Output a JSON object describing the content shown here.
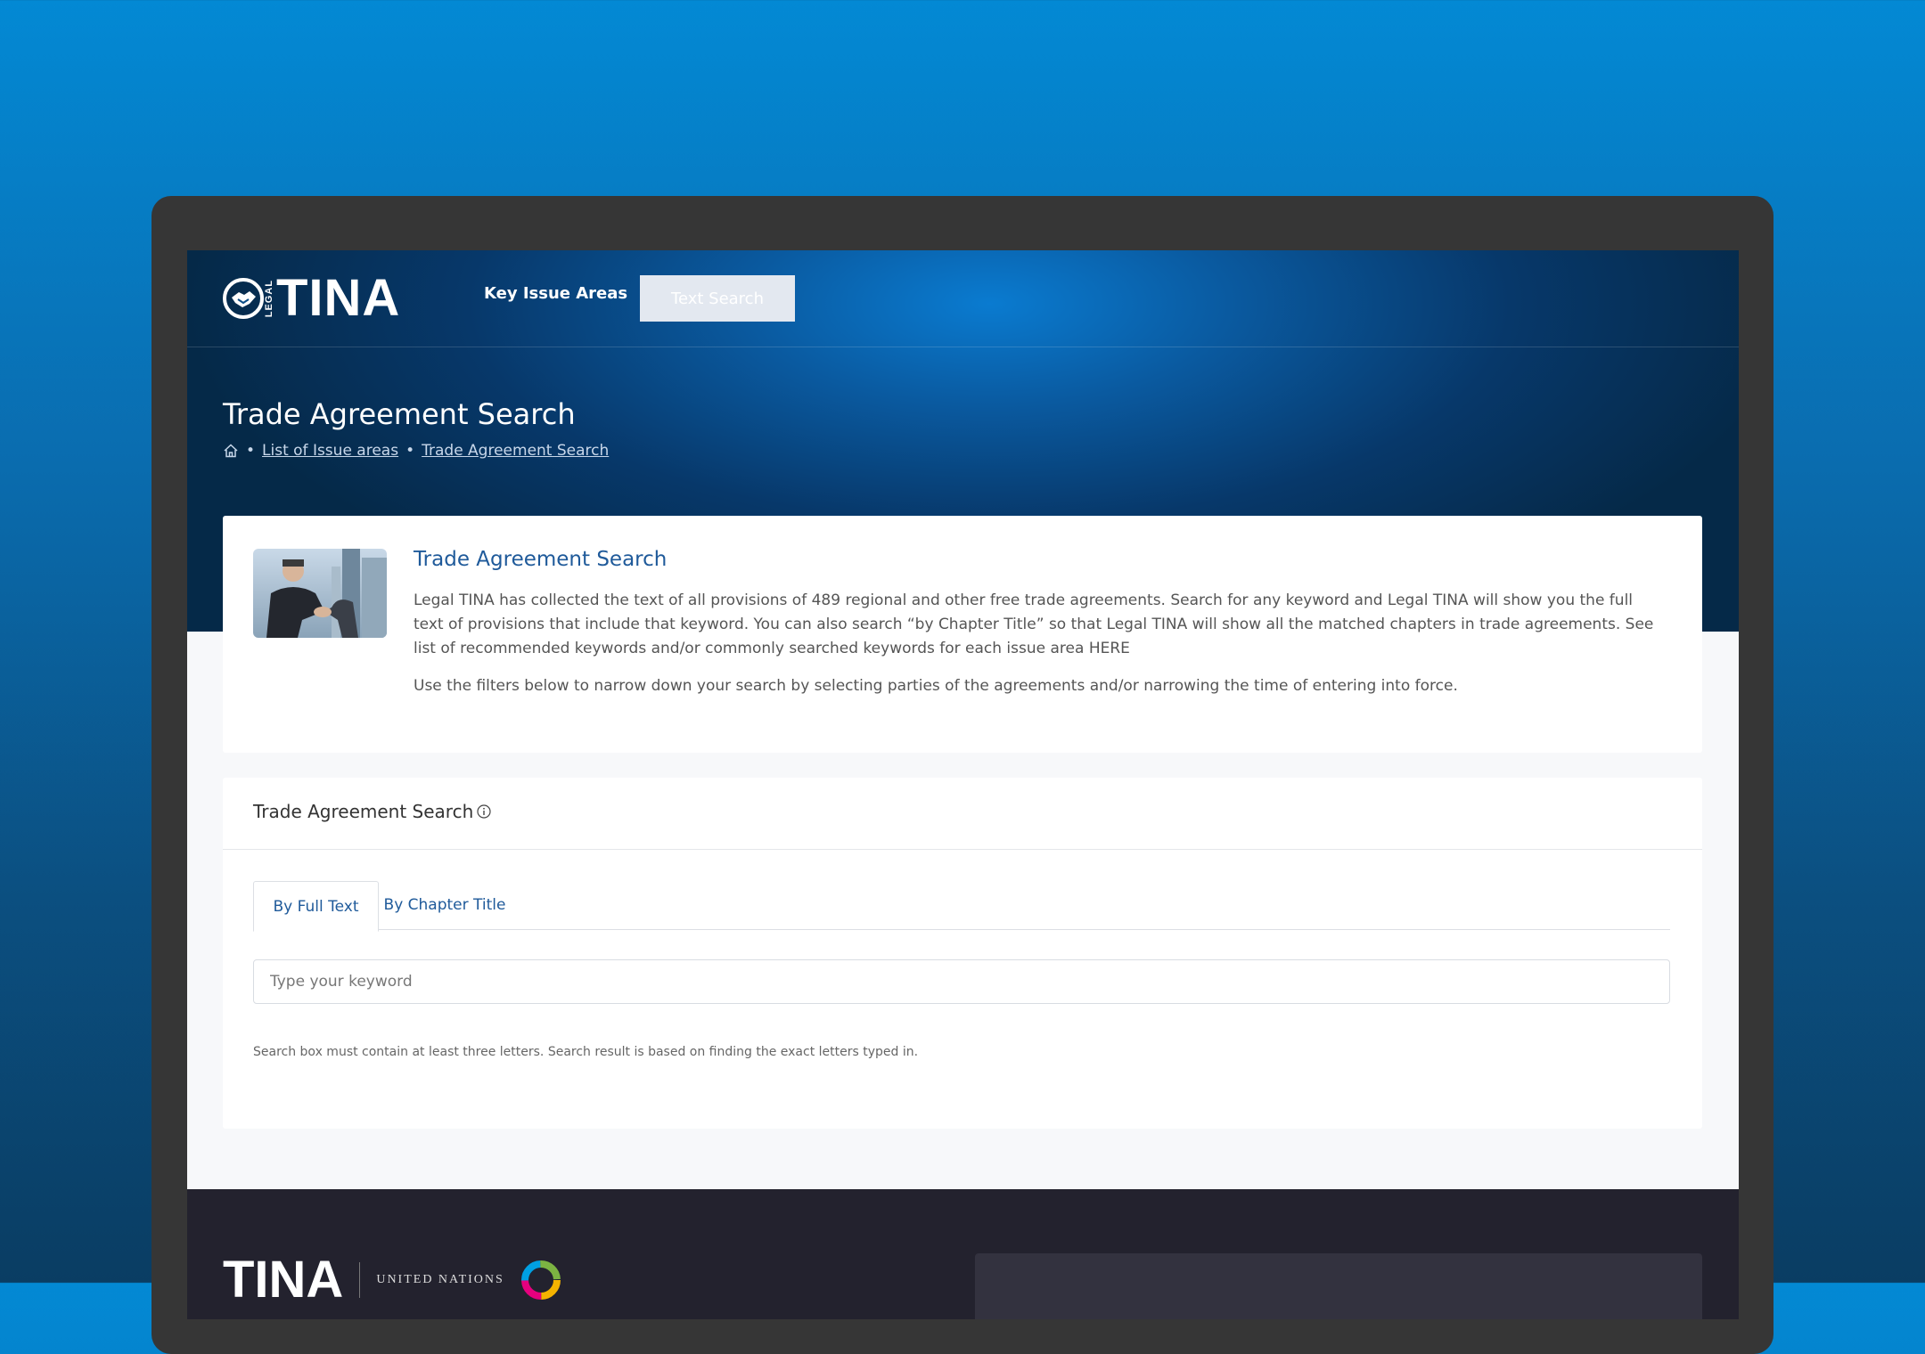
{
  "header": {
    "logo_text": "TINA",
    "logo_sub": "LEGAL",
    "nav": {
      "key_issue_areas": "Key Issue Areas",
      "text_search": "Text Search"
    }
  },
  "hero": {
    "title": "Trade Agreement Search",
    "breadcrumb": {
      "items": [
        "List of Issue areas",
        "Trade Agreement Search"
      ],
      "separator": "•"
    }
  },
  "intro": {
    "title": "Trade Agreement Search",
    "body": "Legal TINA has collected the text of all provisions of 489 regional and other free trade agreements. Search for any keyword and Legal TINA will show you the full text of provisions that include that keyword. You can also search “by Chapter Title” so that Legal TINA will show all the matched chapters in trade agreements. See list of recommended keywords and/or commonly searched keywords for each issue area HERE",
    "body2": "Use the filters below to narrow down your search by selecting parties of the agreements and/or narrowing the time of entering into force."
  },
  "search": {
    "title": "Trade Agreement Search",
    "tabs": [
      "By Full Text",
      "By Chapter Title"
    ],
    "active_tab": "By Full Text",
    "placeholder": "Type your keyword",
    "value": "",
    "hint": "Search box must contain at least three letters. Search result is based on finding the exact letters typed in."
  },
  "footer": {
    "logo_text": "TINA",
    "un_text": "UNITED NATIONS"
  },
  "colors": {
    "background_top": "#0389d4",
    "hero_dark": "#052948",
    "accent_link": "#1f5a9a",
    "footer": "#23222e"
  }
}
